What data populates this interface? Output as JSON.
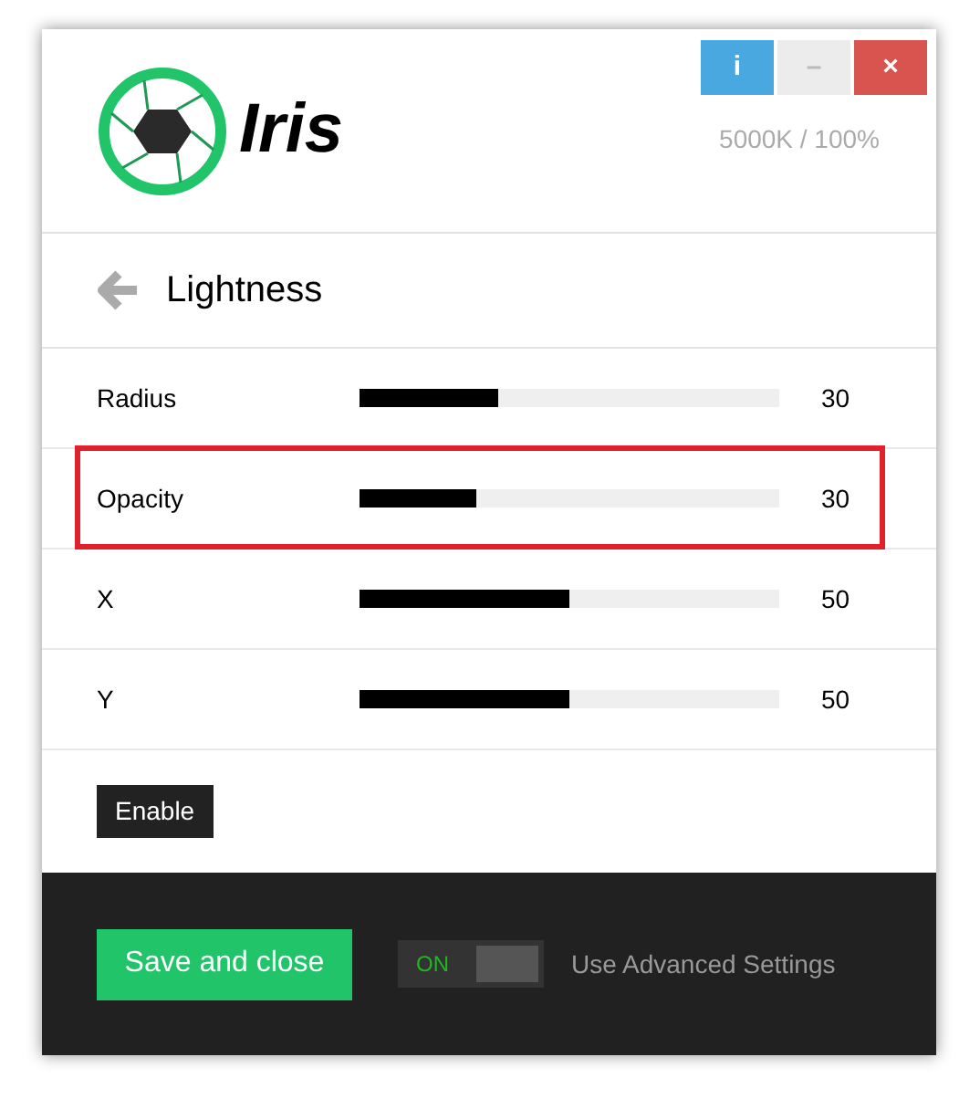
{
  "window": {
    "buttons": [
      {
        "kind": "info",
        "label": "i"
      },
      {
        "kind": "minimize",
        "label": "–"
      },
      {
        "kind": "close",
        "label": "×"
      }
    ]
  },
  "logo": {
    "text": "Iris"
  },
  "status": "5000K / 100%",
  "page_title": "Lightness",
  "sliders": [
    {
      "name": "Radius",
      "level": 0.33,
      "reading": "30",
      "highlighted": false
    },
    {
      "name": "Opacity",
      "level": 0.28,
      "reading": "30",
      "highlighted": true
    },
    {
      "name": "X",
      "level": 0.5,
      "reading": "50",
      "highlighted": false
    },
    {
      "name": "Y",
      "level": 0.5,
      "reading": "50",
      "highlighted": false
    }
  ],
  "enable_button": "Enable",
  "footer": {
    "save_button": "Save and close",
    "toggle": {
      "label": "ON",
      "on": true
    },
    "toggle_caption": "Use Advanced Settings"
  }
}
